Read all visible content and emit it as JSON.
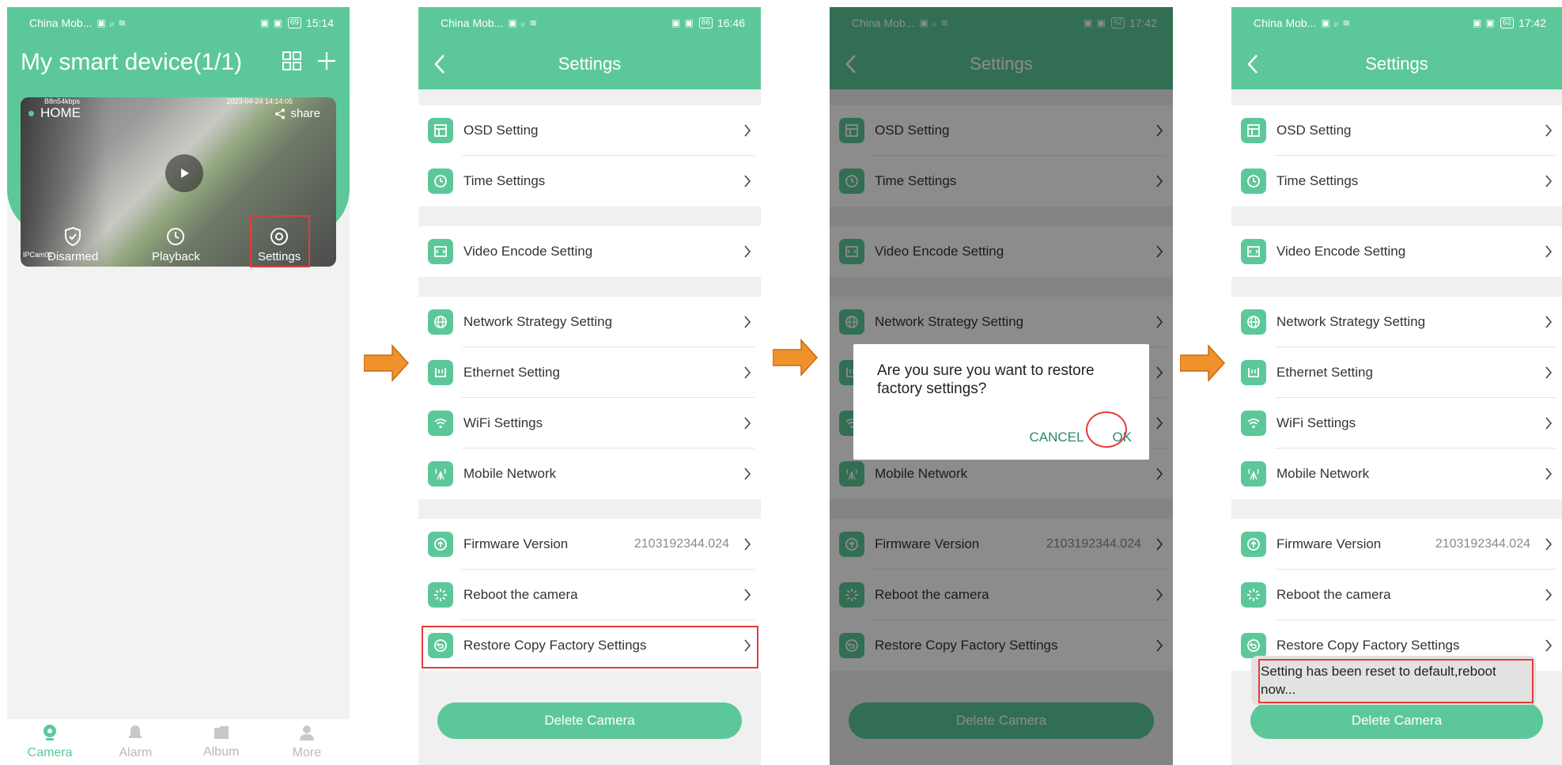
{
  "status_bars": [
    {
      "carrier": "China Mob...",
      "battery": "69",
      "time": "15:14"
    },
    {
      "carrier": "China Mob...",
      "battery": "66",
      "time": "16:46"
    },
    {
      "carrier": "China Mob...",
      "battery": "62",
      "time": "17:42"
    },
    {
      "carrier": "China Mob...",
      "battery": "62",
      "time": "17:42"
    }
  ],
  "home": {
    "title": "My smart device(1/1)",
    "camera": {
      "name": "HOME",
      "share": "share",
      "bitrate": "B8n54kbps",
      "timestamp": "2023-04-24 14:14:05",
      "id_text": "IPCam01",
      "actions": [
        "Disarmed",
        "Playback",
        "Settings"
      ]
    },
    "tabs": [
      "Camera",
      "Alarm",
      "Album",
      "More"
    ],
    "accent": "#5cc89a",
    "highlight_color": "#e63b3b"
  },
  "settings": {
    "title": "Settings",
    "groups": [
      [
        {
          "label": "OSD Setting"
        },
        {
          "label": "Time Settings"
        }
      ],
      [
        {
          "label": "Video Encode Setting"
        }
      ],
      [
        {
          "label": "Network Strategy Setting"
        },
        {
          "label": "Ethernet Setting"
        },
        {
          "label": "WiFi Settings"
        },
        {
          "label": "Mobile Network"
        }
      ],
      [
        {
          "label": "Firmware Version",
          "value": "2103192344.024"
        },
        {
          "label": "Reboot the camera"
        },
        {
          "label": "Restore Copy Factory Settings"
        }
      ]
    ],
    "delete_label": "Delete Camera"
  },
  "dialog": {
    "message": "Are you sure you want to restore factory settings?",
    "cancel": "CANCEL",
    "ok": "OK"
  },
  "toast": {
    "message": "Setting has been reset to default,reboot now..."
  }
}
